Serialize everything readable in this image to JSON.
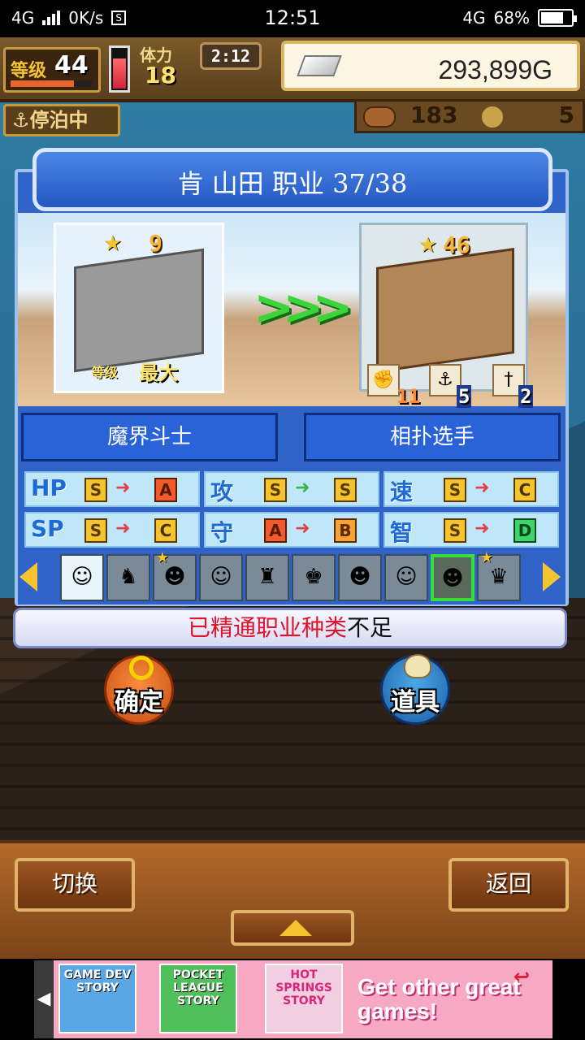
{
  "status_bar": {
    "network": "4G",
    "speed": "0K/s",
    "s_icon": "S",
    "time": "12:51",
    "network_right": "4G",
    "battery": "68%"
  },
  "hud": {
    "level_label": "等级",
    "level_value": "44",
    "level_progress": 0.78,
    "stamina_label": "体力",
    "stamina_value": "18",
    "stamina_fill": 0.72,
    "timer": "2:12",
    "gold": "293,899G",
    "anchor_label": "停泊中",
    "resource1": "183",
    "resource2": "5"
  },
  "panel": {
    "title": "肯 山田 职业 37/38",
    "from_job": {
      "rank": "9",
      "level_label": "等级",
      "max_label": "最大",
      "name": "魔界斗士"
    },
    "to_job": {
      "rank": "46",
      "name": "相扑选手",
      "stats": [
        {
          "icon": "fist-icon",
          "glyph": "✊",
          "value": "11"
        },
        {
          "icon": "anchor-icon",
          "glyph": "⚓",
          "value": "5"
        },
        {
          "icon": "sword-icon",
          "glyph": "🗡",
          "value": "2"
        }
      ]
    },
    "grades": [
      {
        "label": "HP",
        "from": "S",
        "to": "A",
        "same": false
      },
      {
        "label": "攻",
        "from": "S",
        "to": "S",
        "same": true
      },
      {
        "label": "速",
        "from": "S",
        "to": "C",
        "same": false
      },
      {
        "label": "SP",
        "from": "S",
        "to": "C",
        "same": false
      },
      {
        "label": "守",
        "from": "A",
        "to": "B",
        "same": false
      },
      {
        "label": "智",
        "from": "S",
        "to": "D",
        "same": false
      }
    ],
    "roster": [
      {
        "glyph": "☺",
        "star": false
      },
      {
        "glyph": "♞",
        "star": false
      },
      {
        "glyph": "☻",
        "star": true
      },
      {
        "glyph": "☺",
        "star": false
      },
      {
        "glyph": "♜",
        "star": false
      },
      {
        "glyph": "♚",
        "star": false
      },
      {
        "glyph": "☻",
        "star": false
      },
      {
        "glyph": "☺",
        "star": false
      },
      {
        "glyph": "☻",
        "star": false,
        "selected": true
      },
      {
        "glyph": "♛",
        "star": true
      }
    ],
    "message_red": "已精通职业种类",
    "message_black": "不足"
  },
  "actions": {
    "confirm": "确定",
    "item": "道具"
  },
  "bottom": {
    "switch": "切换",
    "back": "返回"
  },
  "ad": {
    "game1": "GAME DEV STORY",
    "game2": "POCKET LEAGUE STORY",
    "game3": "HOT SPRINGS STORY",
    "cta": "Get other great games!"
  },
  "colors": {
    "panel_blue": "#2f63c7",
    "grade_S": "#f4c430",
    "grade_A": "#f05a2c",
    "grade_B": "#f7a234",
    "grade_D": "#3fd26d",
    "arrow_down": "#e0424d",
    "arrow_same": "#39b54a"
  }
}
